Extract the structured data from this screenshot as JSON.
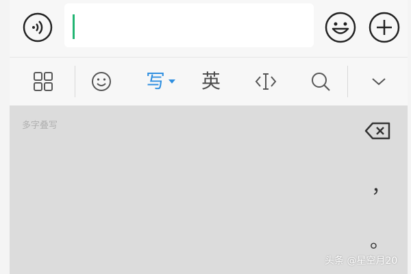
{
  "input": {
    "placeholder": "",
    "value": ""
  },
  "toolbar": {
    "items": [
      {
        "icon": "grid-icon"
      },
      {
        "icon": "smiley-icon"
      },
      {
        "label": "写"
      },
      {
        "label": "英"
      },
      {
        "icon": "cursor-move-icon"
      },
      {
        "icon": "search-icon"
      },
      {
        "icon": "chevron-down-icon"
      }
    ]
  },
  "handwriting": {
    "mode_label": "多字叠写",
    "comma": "，",
    "period": "。"
  },
  "watermark": "头条 @星空月20",
  "colors": {
    "accent": "#2f8fe0",
    "caret": "#22b573",
    "pad_bg": "#dcdcdc"
  }
}
